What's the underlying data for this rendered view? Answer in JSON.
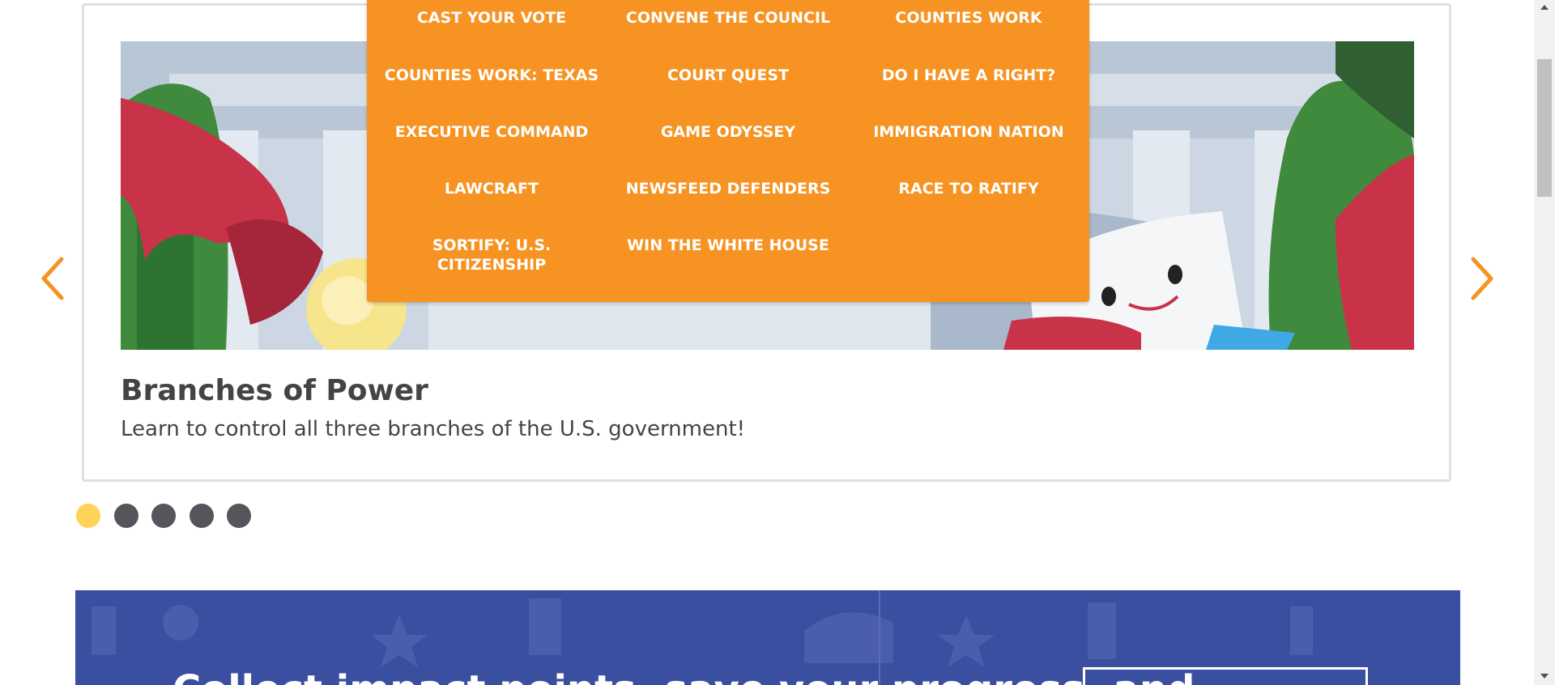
{
  "menu": {
    "items": [
      "CAST YOUR VOTE",
      "CONVENE THE COUNCIL",
      "COUNTIES WORK",
      "COUNTIES WORK: TEXAS",
      "COURT QUEST",
      "DO I HAVE A RIGHT?",
      "EXECUTIVE COMMAND",
      "GAME ODYSSEY",
      "IMMIGRATION NATION",
      "LAWCRAFT",
      "NEWSFEED DEFENDERS",
      "RACE TO RATIFY",
      "SORTIFY: U.S. CITIZENSHIP",
      "WIN THE WHITE HOUSE"
    ]
  },
  "carousel": {
    "slide_title": "Branches of Power",
    "slide_description": "Learn to control all three branches of the U.S. government!",
    "prev_icon": "chevron-left-icon",
    "next_icon": "chevron-right-icon",
    "dot_count": 5,
    "active_dot": 1
  },
  "banner": {
    "text": "Collect impact points, save your progress, and"
  },
  "colors": {
    "accent_orange": "#f69322",
    "dot_active": "#ffd25a",
    "dot_inactive": "#55565b",
    "banner_blue": "#3b4fa0",
    "text_dark": "#444444"
  }
}
